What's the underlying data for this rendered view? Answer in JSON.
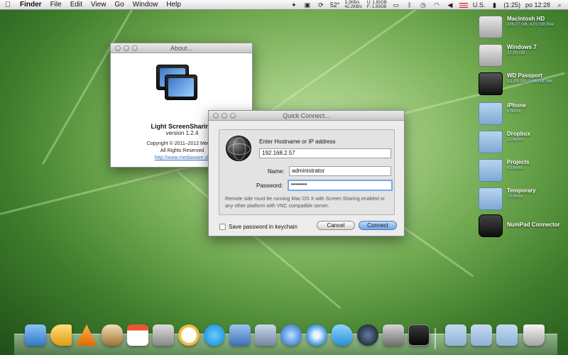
{
  "menubar": {
    "apple_icon": "apple-icon",
    "app_name": "Finder",
    "menus": [
      "File",
      "Edit",
      "View",
      "Go",
      "Window",
      "Help"
    ],
    "status": {
      "temperature": "52°",
      "net_up": "3.2KB/s",
      "net_down": "42.2KB/s",
      "mem_used": "U: 1.82GB",
      "mem_free": "F: 1.93GB",
      "country": "U.S.",
      "battery": "(1:25)",
      "clock": "po 12:28"
    }
  },
  "desktop": {
    "items": [
      {
        "title": "Macintosh HD",
        "sub": "226,27 GB, 4,01 GB free",
        "icon": "disk"
      },
      {
        "title": "Windows 7",
        "sub": "22,93 GB",
        "icon": "disk"
      },
      {
        "title": "WD Passport",
        "sub": "1,1,09 GB, 5,86 GB free",
        "icon": "disk-dark"
      },
      {
        "title": "iPhone",
        "sub": "6 items",
        "icon": "folder"
      },
      {
        "title": "Dropbox",
        "sub": "21 items",
        "icon": "folder"
      },
      {
        "title": "Projects",
        "sub": "63 items",
        "icon": "folder"
      },
      {
        "title": "Temporary",
        "sub": "73 items",
        "icon": "folder"
      },
      {
        "title": "NumPad Connector",
        "sub": "",
        "icon": "app-black"
      }
    ]
  },
  "about": {
    "title": "About...",
    "app_name": "Light ScreenSharing",
    "version": "version 1.2.4",
    "copyright": "Copyright © 2011–2012 Mediaw",
    "rights": "All Rights Reserved",
    "link": "http://www.mediaware.sk"
  },
  "quick_connect": {
    "title": "Quick Connect...",
    "host_label": "Enter Hostname or IP address",
    "host_value": "192.168.2.57",
    "name_label": "Name:",
    "name_value": "administrator",
    "password_label": "Password:",
    "password_value": "••••••••",
    "note": "Remote side must be running Mac OS X with Screen Sharing enabled or any other platform with VNC compatible server.",
    "save_label": "Save password in keychain",
    "cancel_label": "Cancel",
    "connect_label": "Connect"
  },
  "dock": {
    "apps": [
      "Finder",
      "Growl",
      "VLC",
      "Coffee",
      "Calendar",
      "Preview",
      "Adium",
      "Skype",
      "Xcode",
      "Eagle",
      "iTunes",
      "Safari",
      "Twitter",
      "Camera",
      "System Preferences",
      "Terminal"
    ],
    "folders": [
      "Applications",
      "Documents",
      "Downloads"
    ],
    "trash": "Trash"
  }
}
